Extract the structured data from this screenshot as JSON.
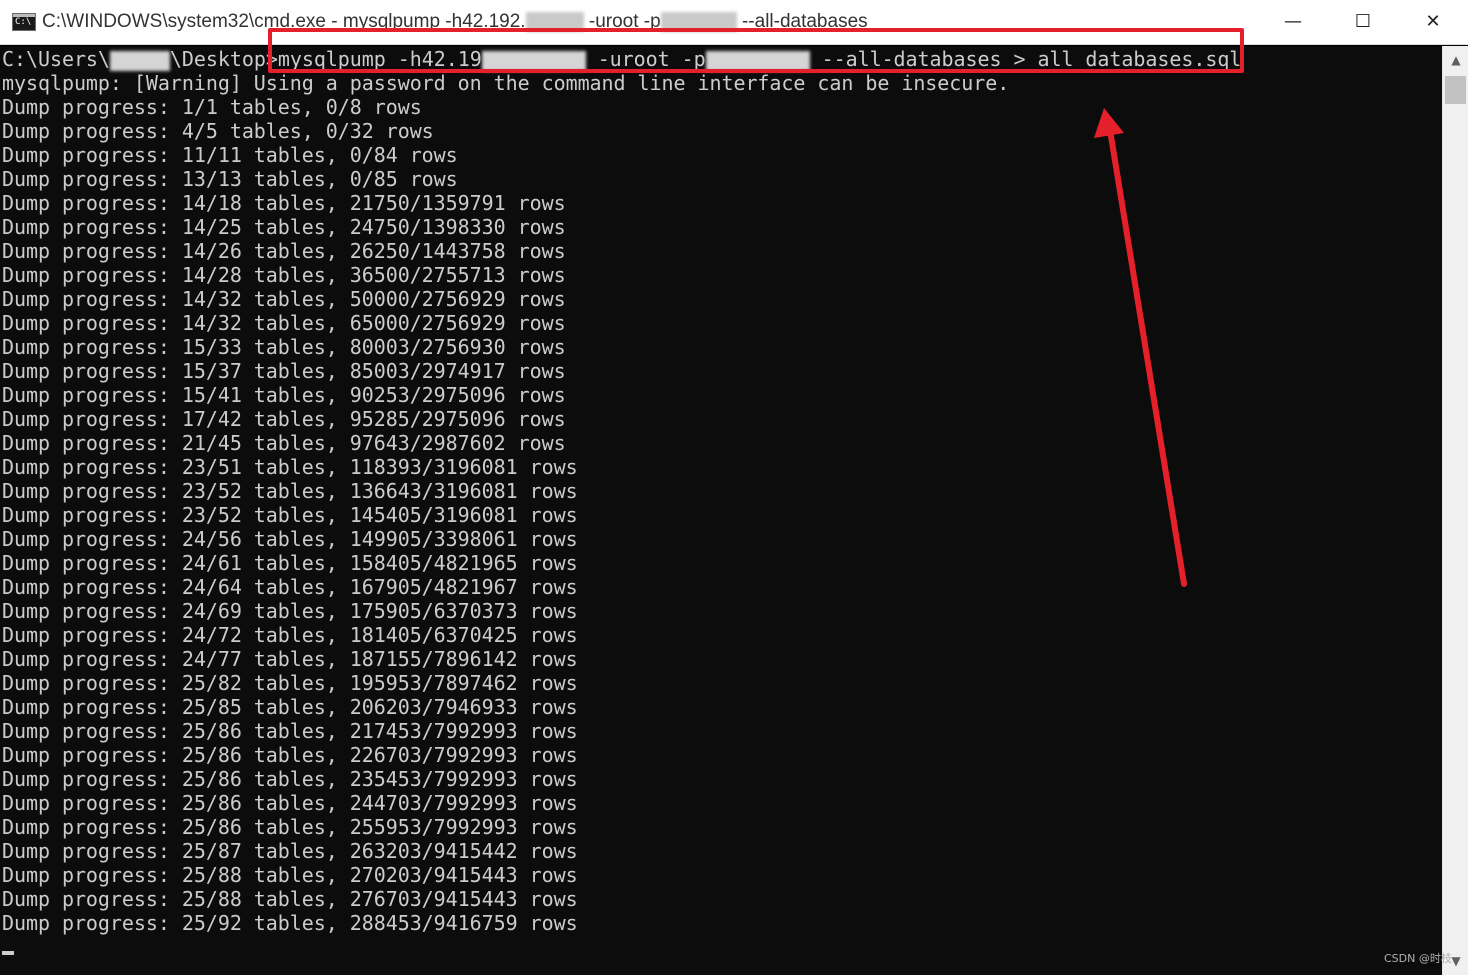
{
  "window": {
    "icon_label": "C:\\",
    "title_part1": "C:\\WINDOWS\\system32\\cmd.exe - mysqlpump  -h42.192.",
    "title_part2": " -uroot -p",
    "title_part3": " --all-databases",
    "minimize_symbol": "—",
    "maximize_symbol": "☐",
    "close_symbol": "✕"
  },
  "console": {
    "prompt_part1": "C:\\Users\\",
    "prompt_part2": "\\Desktop>",
    "command_part1": "mysqlpump -h42.19",
    "command_part2": " -uroot -p",
    "command_part3": " --all-databases > all_databases.sql",
    "warning": "mysqlpump: [Warning] Using a password on the command line interface can be insecure.",
    "progress_lines": [
      "Dump progress: 1/1 tables, 0/8 rows",
      "Dump progress: 4/5 tables, 0/32 rows",
      "Dump progress: 11/11 tables, 0/84 rows",
      "Dump progress: 13/13 tables, 0/85 rows",
      "Dump progress: 14/18 tables, 21750/1359791 rows",
      "Dump progress: 14/25 tables, 24750/1398330 rows",
      "Dump progress: 14/26 tables, 26250/1443758 rows",
      "Dump progress: 14/28 tables, 36500/2755713 rows",
      "Dump progress: 14/32 tables, 50000/2756929 rows",
      "Dump progress: 14/32 tables, 65000/2756929 rows",
      "Dump progress: 15/33 tables, 80003/2756930 rows",
      "Dump progress: 15/37 tables, 85003/2974917 rows",
      "Dump progress: 15/41 tables, 90253/2975096 rows",
      "Dump progress: 17/42 tables, 95285/2975096 rows",
      "Dump progress: 21/45 tables, 97643/2987602 rows",
      "Dump progress: 23/51 tables, 118393/3196081 rows",
      "Dump progress: 23/52 tables, 136643/3196081 rows",
      "Dump progress: 23/52 tables, 145405/3196081 rows",
      "Dump progress: 24/56 tables, 149905/3398061 rows",
      "Dump progress: 24/61 tables, 158405/4821965 rows",
      "Dump progress: 24/64 tables, 167905/4821967 rows",
      "Dump progress: 24/69 tables, 175905/6370373 rows",
      "Dump progress: 24/72 tables, 181405/6370425 rows",
      "Dump progress: 24/77 tables, 187155/7896142 rows",
      "Dump progress: 25/82 tables, 195953/7897462 rows",
      "Dump progress: 25/85 tables, 206203/7946933 rows",
      "Dump progress: 25/86 tables, 217453/7992993 rows",
      "Dump progress: 25/86 tables, 226703/7992993 rows",
      "Dump progress: 25/86 tables, 235453/7992993 rows",
      "Dump progress: 25/86 tables, 244703/7992993 rows",
      "Dump progress: 25/86 tables, 255953/7992993 rows",
      "Dump progress: 25/87 tables, 263203/9415442 rows",
      "Dump progress: 25/88 tables, 270203/9415443 rows",
      "Dump progress: 25/88 tables, 276703/9415443 rows",
      "Dump progress: 25/92 tables, 288453/9416759 rows"
    ]
  },
  "scrollbar": {
    "up_symbol": "▲",
    "down_symbol": "▼"
  },
  "watermark": "CSDN @时枝",
  "colors": {
    "annotation_red": "#e5202a",
    "console_bg": "#0c0c0c",
    "console_text": "#cccccc"
  }
}
